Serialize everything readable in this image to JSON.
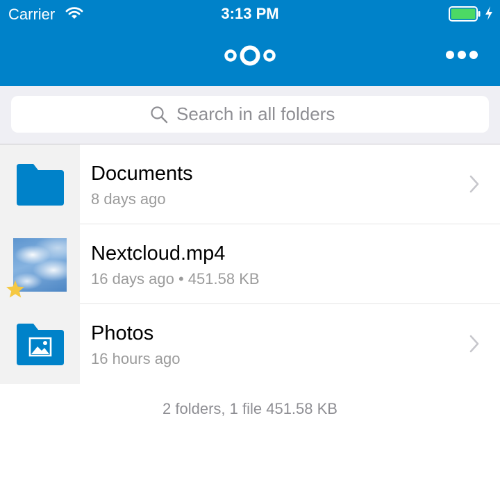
{
  "status_bar": {
    "carrier": "Carrier",
    "time": "3:13 PM",
    "icons": [
      "wifi-icon",
      "battery-icon",
      "charging-icon"
    ]
  },
  "header": {
    "logo": "nextcloud-logo-icon",
    "menu_icon": "more-icon"
  },
  "search": {
    "placeholder": "Search in all folders",
    "value": ""
  },
  "files": [
    {
      "name": "Documents",
      "meta": "8 days ago",
      "type": "folder",
      "icon": "folder-icon"
    },
    {
      "name": "Nextcloud.mp4",
      "meta": "16 days ago • 451.58 KB",
      "type": "file",
      "icon": "video-thumbnail",
      "favorite": true
    },
    {
      "name": "Photos",
      "meta": "16 hours ago",
      "type": "folder",
      "icon": "image-folder-icon"
    }
  ],
  "footer": {
    "summary": "2 folders, 1 file 451.58 KB"
  },
  "colors": {
    "brand": "#0082c9",
    "favorite": "#f5c842",
    "secondary_text": "#9b9b9b"
  }
}
